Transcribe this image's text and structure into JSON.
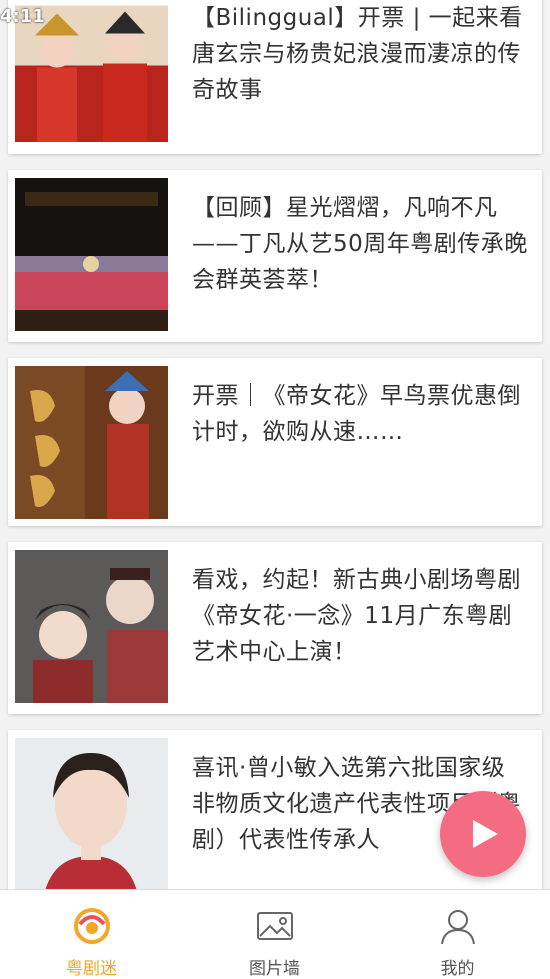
{
  "status_bar": {
    "time": "4:11"
  },
  "articles": [
    {
      "title": "【Bilinggual】开票 | 一起来看唐玄宗与杨贵妃浪漫而凄凉的传奇故事"
    },
    {
      "title": "【回顾】星光熠熠，凡响不凡——丁凡从艺50周年粤剧传承晚会群英荟萃！"
    },
    {
      "title": "开票｜《帝女花》早鸟票优惠倒计时，欲购从速……"
    },
    {
      "title": "看戏，约起！新古典小剧场粤剧《帝女花·一念》11月广东粤剧艺术中心上演！"
    },
    {
      "title": "喜讯·曾小敏入选第六批国家级非物质文化遗产代表性项目（粤剧）代表性传承人"
    }
  ],
  "tabs": [
    {
      "label": "粤剧迷",
      "icon": "opera-logo-icon",
      "active": true
    },
    {
      "label": "图片墙",
      "icon": "image-icon",
      "active": false
    },
    {
      "label": "我的",
      "icon": "user-icon",
      "active": false
    }
  ],
  "fab": {
    "icon": "play-icon"
  },
  "colors": {
    "accent": "#f5a623",
    "fab": "#f46c82",
    "text": "#333333"
  }
}
